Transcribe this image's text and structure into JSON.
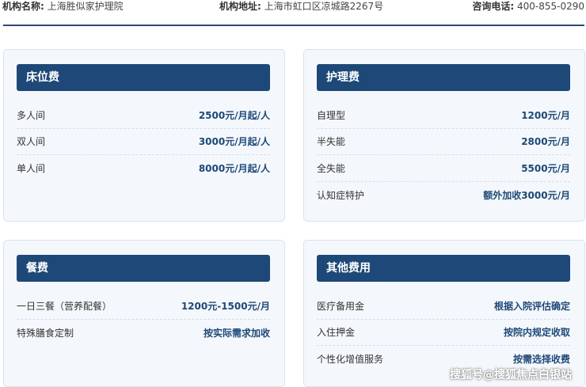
{
  "header": {
    "name_label": "机构名称:",
    "name_value": "上海胜似家护理院",
    "address_label": "机构地址:",
    "address_value": "上海市虹口区凉城路2267号",
    "phone_label": "咨询电话:",
    "phone_value": "400-855-0290"
  },
  "cards": [
    {
      "title": "床位费",
      "rows": [
        {
          "name": "多人间",
          "price": "2500元/月起/人"
        },
        {
          "name": "双人间",
          "price": "3000元/月起/人"
        },
        {
          "name": "单人间",
          "price": "8000元/月起/人"
        }
      ]
    },
    {
      "title": "护理费",
      "rows": [
        {
          "name": "自理型",
          "price": "1200元/月"
        },
        {
          "name": "半失能",
          "price": "2800元/月"
        },
        {
          "name": "全失能",
          "price": "5500元/月"
        },
        {
          "name": "认知症特护",
          "price": "额外加收3000元/月"
        }
      ]
    },
    {
      "title": "餐费",
      "rows": [
        {
          "name": "一日三餐（营养配餐）",
          "price": "1200元-1500元/月"
        },
        {
          "name": "特殊膳食定制",
          "price": "按实际需求加收"
        }
      ]
    },
    {
      "title": "其他费用",
      "rows": [
        {
          "name": "医疗备用金",
          "price": "根据入院评估确定"
        },
        {
          "name": "入住押金",
          "price": "按院内规定收取"
        },
        {
          "name": "个性化增值服务",
          "price": "按需选择收费"
        }
      ]
    }
  ],
  "watermark": "搜狐号@搜狐焦点白银站",
  "colors": {
    "accent": "#1e4877",
    "card_bg": "#f4f8fc",
    "card_border": "#d6e3ef"
  }
}
